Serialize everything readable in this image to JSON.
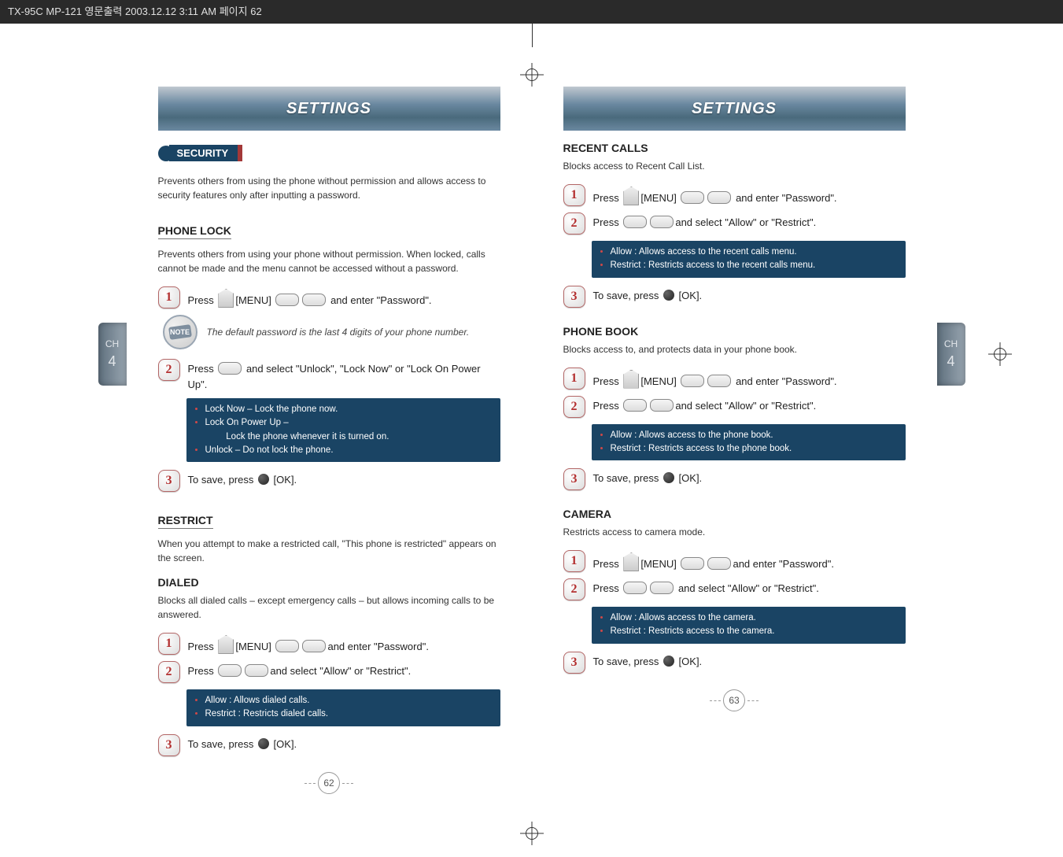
{
  "header_strip": "TX-95C MP-121 영문출력  2003.12.12 3:11 AM  페이지 62",
  "chapter_tab": {
    "label_ch": "CH",
    "label_num": "4"
  },
  "left_page": {
    "title": "SETTINGS",
    "pill": "SECURITY",
    "intro": "Prevents others from using the phone without permission and allows access to security features only after inputting a password.",
    "phone_lock": {
      "heading": "PHONE LOCK",
      "intro": "Prevents others from using your phone without permission. When locked, calls cannot be made and the menu cannot be accessed without a password.",
      "step1": "Press    [MENU]         and enter \"Password\".",
      "note": "The default password is the last 4 digits of your phone number.",
      "step2": "Press     and select \"Unlock\", \"Lock Now\" or \"Lock On Power Up\".",
      "bullets": [
        "Lock Now – Lock the phone now.",
        "Lock On Power Up –",
        "    Lock the phone whenever it is turned on.",
        "Unlock – Do not lock the phone."
      ],
      "step3": "To save, press    [OK]."
    },
    "restrict": {
      "heading": "RESTRICT",
      "intro": "When you attempt to make a restricted call, \"This phone is restricted\" appears on the screen."
    },
    "dialed": {
      "heading": "DIALED",
      "intro": "Blocks all dialed calls – except emergency calls – but allows incoming calls to be answered.",
      "step1": "Press    [MENU]        and enter \"Password\".",
      "step2": "Press         and select \"Allow\" or \"Restrict\".",
      "bullets": [
        "Allow : Allows dialed calls.",
        "Restrict : Restricts dialed calls."
      ],
      "step3": "To save, press    [OK]."
    },
    "page_number": "62"
  },
  "right_page": {
    "title": "SETTINGS",
    "recent_calls": {
      "heading": "RECENT CALLS",
      "intro": "Blocks access to Recent Call List.",
      "step1": "Press    [MENU]         and enter \"Password\".",
      "step2": "Press         and select \"Allow\" or \"Restrict\".",
      "bullets": [
        "Allow : Allows access to the recent calls menu.",
        "Restrict : Restricts access to the recent calls menu."
      ],
      "step3": "To save, press    [OK]."
    },
    "phone_book": {
      "heading": "PHONE BOOK",
      "intro": "Blocks access to, and protects data in your phone book.",
      "step1": "Press    [MENU]         and enter \"Password\".",
      "step2": "Press         and select \"Allow\" or \"Restrict\".",
      "bullets": [
        "Allow : Allows access to the phone book.",
        "Restrict : Restricts access to the phone book."
      ],
      "step3": "To save, press    [OK]."
    },
    "camera": {
      "heading": "CAMERA",
      "intro": "Restricts access to camera mode.",
      "step1": "Press    [MENU]        and enter \"Password\".",
      "step2": "Press          and select \"Allow\" or \"Restrict\".",
      "bullets": [
        "Allow : Allows access to the camera.",
        "Restrict : Restricts access to the camera."
      ],
      "step3": "To save, press    [OK]."
    },
    "page_number": "63"
  }
}
